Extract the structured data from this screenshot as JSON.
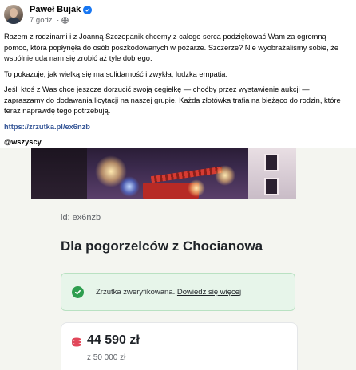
{
  "post": {
    "author": "Paweł Bujak",
    "time": "7 godz.",
    "separator": "·",
    "paragraphs": [
      "Razem z rodzinami i z Joanną Szczepanik chcemy z całego serca podziękować Wam za ogromną pomoc, która popłynęła do osób poszkodowanych w pożarze. Szczerze? Nie wyobrażaliśmy sobie, że wspólnie uda nam się zrobić aż tyle dobrego.",
      "To pokazuje, jak wielką się ma solidarność i zwykła, ludzka empatia.",
      "Jeśli ktoś z Was chce jeszcze dorzucić swoją cegiełkę — choćby przez wystawienie aukcji — zapraszamy do dodawania licytacji na naszej grupie. Każda złotówka trafia na bieżąco do rodzin, które teraz naprawdę tego potrzebują."
    ],
    "link": "https://zrzutka.pl/ex6nzb",
    "tag": "@wszyscy"
  },
  "fundraiser": {
    "id_label": "id: ex6nzb",
    "title": "Dla pogorzelców z Chocianowa",
    "verified_text": "Zrzutka zweryfikowana.",
    "verified_link": "Dowiedz się więcej",
    "amount": "44 590 zł",
    "goal": "z 50 000 zł"
  },
  "icons": {
    "verified": "verified-badge-icon",
    "audience": "globe-icon",
    "check": "check-circle-icon",
    "coins": "coins-icon"
  },
  "colors": {
    "facebook_blue": "#1877f2",
    "link": "#385898",
    "verified_green": "#2e9e4f",
    "coins_red": "#e2475a"
  }
}
